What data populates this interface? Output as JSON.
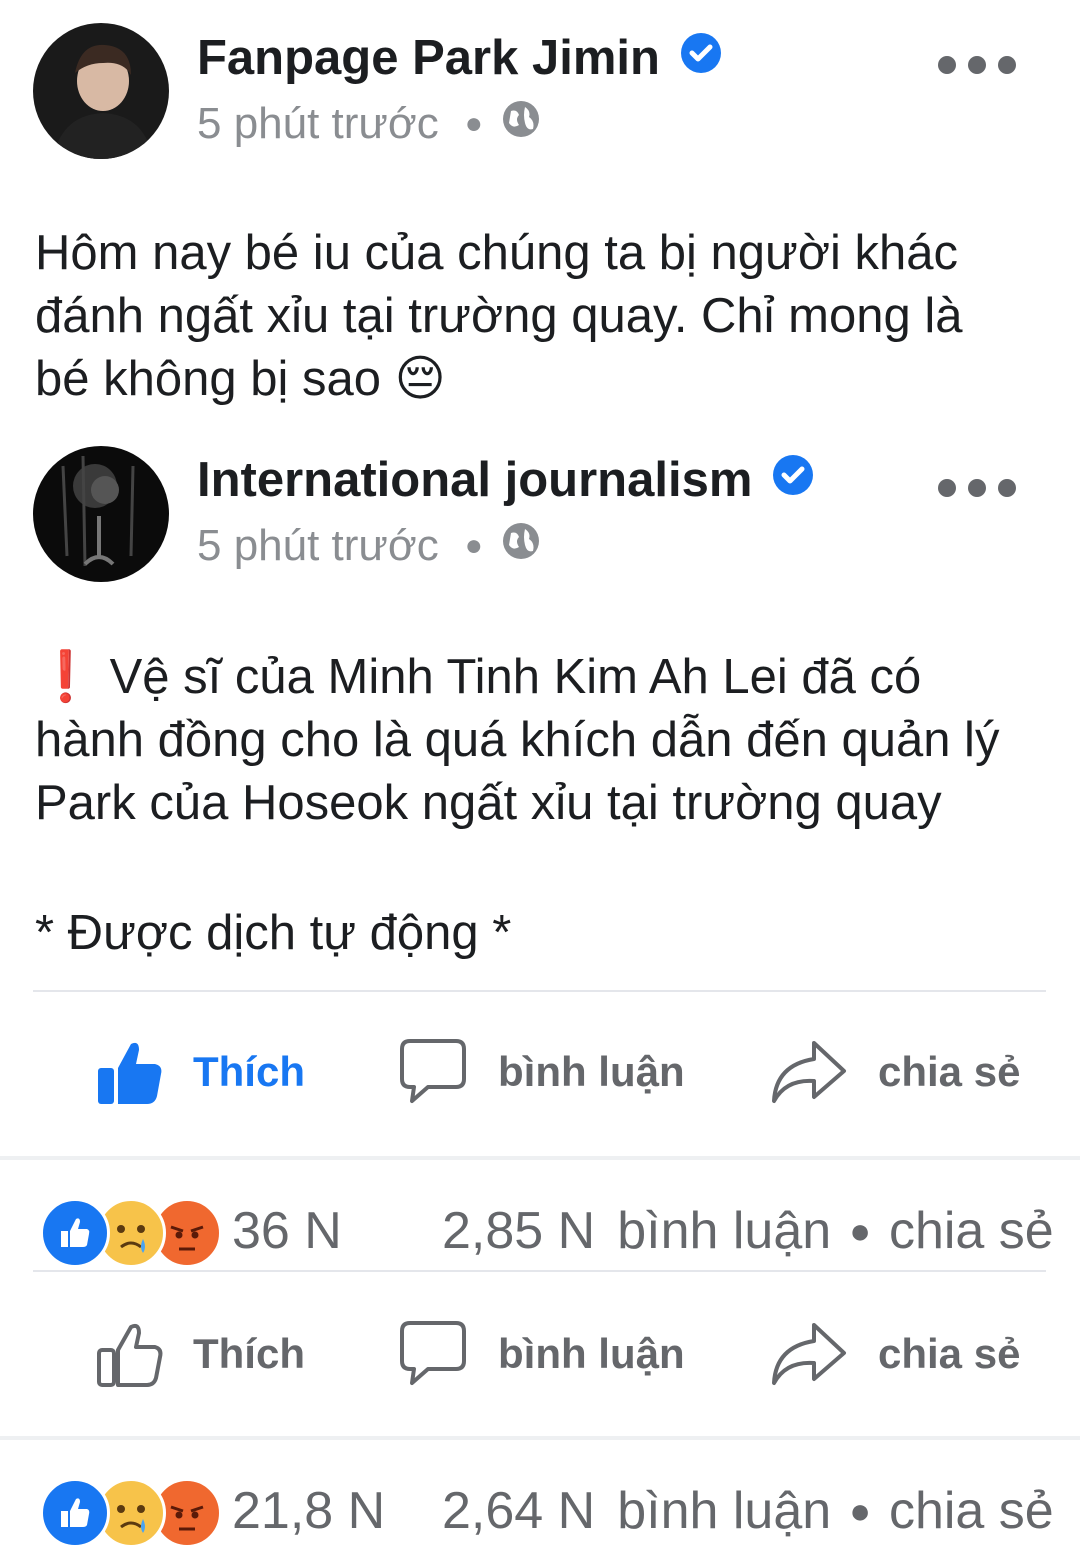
{
  "post1": {
    "author": "Fanpage Park Jimin",
    "time": "5 phút trước",
    "text": "Hôm nay bé iu của chúng ta bị người khác\nđánh ngất xỉu tại trường quay. Chỉ mong là\nbé không bị sao 😔"
  },
  "post2": {
    "author": "International journalism",
    "time": "5 phút trước",
    "text": "❗ Vệ sĩ của Minh Tinh Kim Ah Lei đã có\nhành đồng cho là quá khích dẫn đến quản lý\nPark của Hoseok ngất xỉu tại trường quay",
    "translated_note": "* Được dịch tự động *"
  },
  "actions": {
    "like": "Thích",
    "comment": "bình luận",
    "share": "chia sẻ"
  },
  "stats1": {
    "reactions": "36 N",
    "comments_count": "2,85 N",
    "comments_label": "bình luận",
    "share_label": "chia sẻ"
  },
  "stats2": {
    "reactions": "21,8 N",
    "comments_count": "2,64 N",
    "comments_label": "bình luận",
    "share_label": "chia sẻ"
  },
  "colors": {
    "accent": "#1877f2",
    "muted": "#65676b",
    "meta": "#8a8d91"
  },
  "icons": [
    "avatar",
    "verified-icon",
    "globe-icon",
    "more-icon",
    "like-icon",
    "comment-icon",
    "share-icon",
    "like-reaction-icon",
    "sad-reaction-icon",
    "angry-reaction-icon"
  ]
}
